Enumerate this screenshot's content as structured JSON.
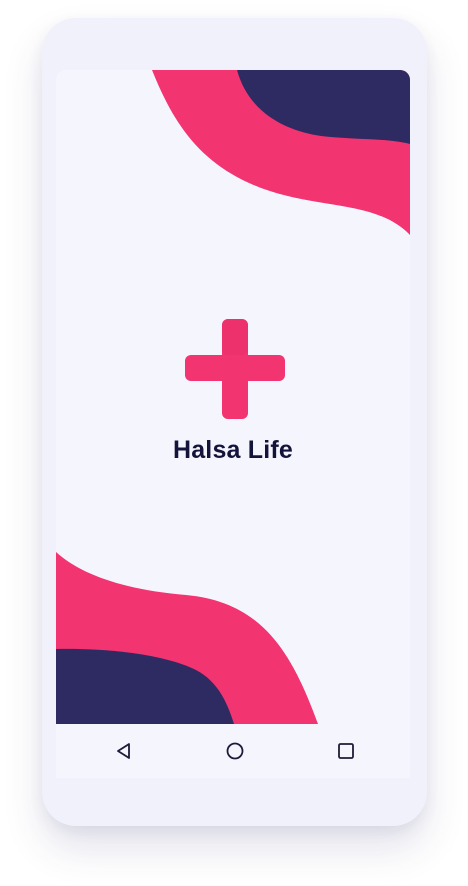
{
  "app": {
    "name": "Halsa Life"
  },
  "colors": {
    "brand_pink": "#f23470",
    "brand_navy": "#2e2b63",
    "screen_bg": "#f5f5fe",
    "title_text": "#14143a",
    "nav_icon": "#1c1c3a"
  },
  "logo": {
    "icon": "medical-cross-icon"
  },
  "navbar": {
    "back_icon": "triangle-back-icon",
    "home_icon": "circle-home-icon",
    "recents_icon": "square-recents-icon"
  }
}
